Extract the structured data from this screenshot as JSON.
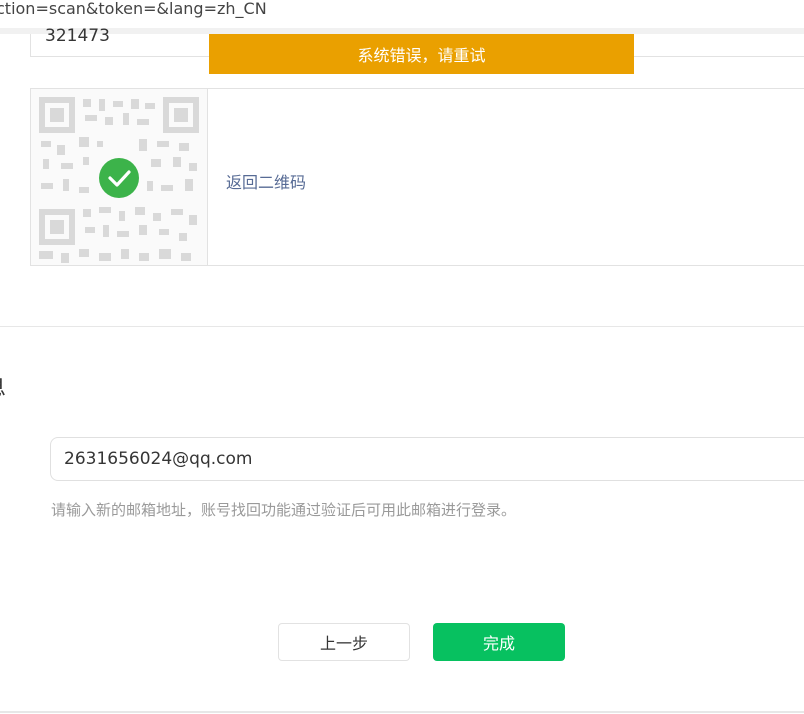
{
  "browser": {
    "url_fragment": "ction=scan&token=&lang=zh_CN"
  },
  "verify": {
    "code_value": "321473"
  },
  "toast": {
    "message": "系统错误，请重试"
  },
  "qr": {
    "back_link": "返回二维码",
    "status": "scanned",
    "check_color": "#3cb34a"
  },
  "section": {
    "title": "息"
  },
  "email": {
    "value": "2631656024@qq.com",
    "hint": "请输入新的邮箱地址，账号找回功能通过验证后可用此邮箱进行登录。"
  },
  "buttons": {
    "prev": "上一步",
    "done": "完成"
  },
  "colors": {
    "toast_bg": "#eaa000",
    "primary": "#07c160",
    "link": "#576b95"
  }
}
